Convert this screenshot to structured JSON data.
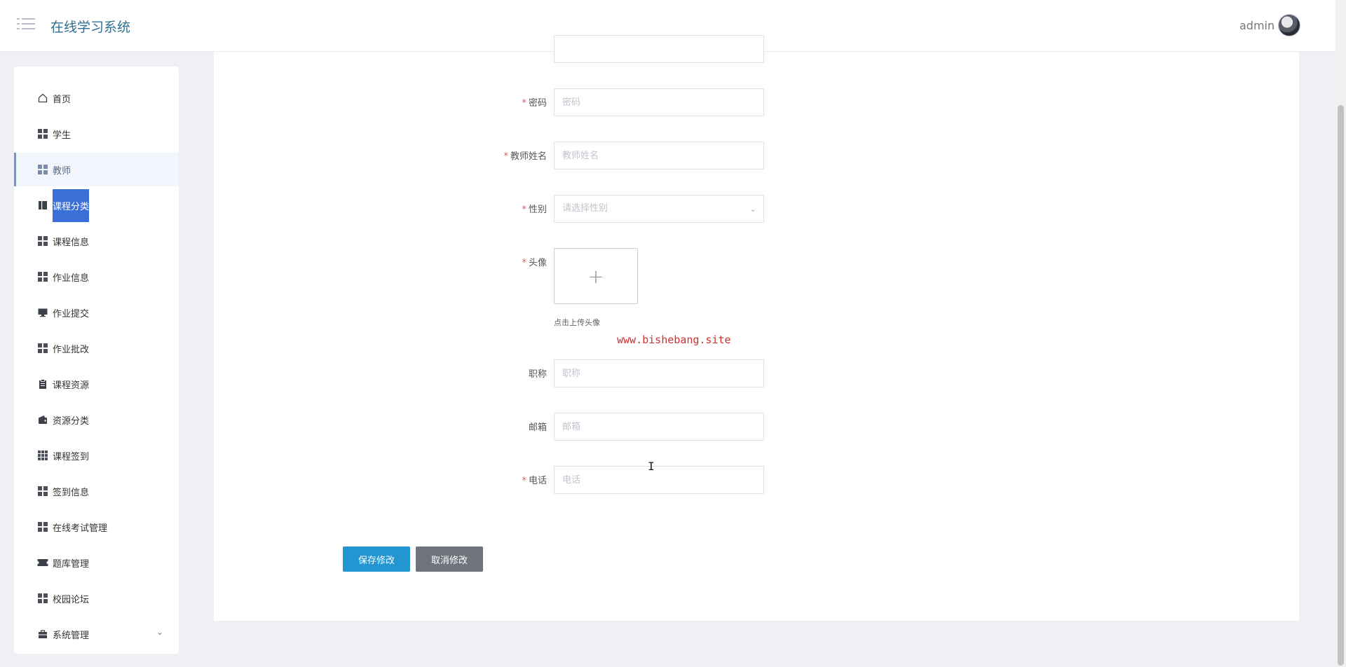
{
  "header": {
    "app_title": "在线学习系统",
    "user_name": "admin"
  },
  "sidebar": {
    "items": [
      {
        "label": "首页",
        "icon": "home-icon"
      },
      {
        "label": "学生",
        "icon": "grid-icon"
      },
      {
        "label": "教师",
        "icon": "grid-icon",
        "active": true
      },
      {
        "label": "课程分类",
        "icon": "book-icon",
        "selected_text": true
      },
      {
        "label": "课程信息",
        "icon": "grid-icon"
      },
      {
        "label": "作业信息",
        "icon": "grid-icon"
      },
      {
        "label": "作业提交",
        "icon": "monitor-icon"
      },
      {
        "label": "作业批改",
        "icon": "grid-icon"
      },
      {
        "label": "课程资源",
        "icon": "clipboard-icon"
      },
      {
        "label": "资源分类",
        "icon": "wallet-icon"
      },
      {
        "label": "课程签到",
        "icon": "grid9-icon"
      },
      {
        "label": "签到信息",
        "icon": "grid-icon"
      },
      {
        "label": "在线考试管理",
        "icon": "grid-icon"
      },
      {
        "label": "题库管理",
        "icon": "ticket-icon"
      },
      {
        "label": "校园论坛",
        "icon": "grid-icon"
      },
      {
        "label": "系统管理",
        "icon": "briefcase-icon",
        "expandable": true
      }
    ]
  },
  "form": {
    "password": {
      "label": "密码",
      "required": true,
      "placeholder": "密码",
      "value": ""
    },
    "teacher_name": {
      "label": "教师姓名",
      "required": true,
      "placeholder": "教师姓名",
      "value": ""
    },
    "gender": {
      "label": "性别",
      "required": true,
      "placeholder": "请选择性别"
    },
    "avatar": {
      "label": "头像",
      "required": true,
      "tip": "点击上传头像"
    },
    "title": {
      "label": "职称",
      "required": false,
      "placeholder": "职称",
      "value": ""
    },
    "email": {
      "label": "邮箱",
      "required": false,
      "placeholder": "邮箱",
      "value": ""
    },
    "phone": {
      "label": "电话",
      "required": true,
      "placeholder": "电话",
      "value": ""
    }
  },
  "buttons": {
    "save": "保存修改",
    "cancel": "取消修改"
  },
  "watermark": "www.bishebang.site",
  "colors": {
    "primary": "#2396d1",
    "cancel": "#6f747c",
    "brand_text": "#2f6f8f",
    "required": "#e05b5b",
    "selection": "#3a6fd8"
  }
}
